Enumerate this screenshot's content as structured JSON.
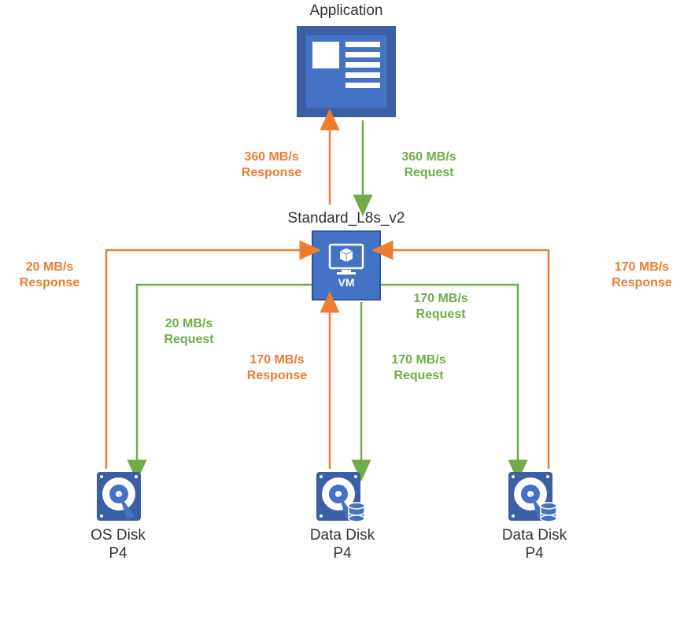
{
  "colors": {
    "primary_blue": "#4472C4",
    "request_green": "#70AD47",
    "response_orange": "#ED7D31"
  },
  "nodes": {
    "application": {
      "label": "Application"
    },
    "vm": {
      "label": "Standard_L8s_v2",
      "caption": "VM"
    },
    "os_disk": {
      "label_line1": "OS Disk",
      "label_line2": "P4"
    },
    "data_disk_1": {
      "label_line1": "Data Disk",
      "label_line2": "P4"
    },
    "data_disk_2": {
      "label_line1": "Data Disk",
      "label_line2": "P4"
    }
  },
  "flows": {
    "app_response": {
      "line1": "360 MB/s",
      "line2": "Response"
    },
    "app_request": {
      "line1": "360 MB/s",
      "line2": "Request"
    },
    "os_response": {
      "line1": "20 MB/s",
      "line2": "Response"
    },
    "os_request": {
      "line1": "20 MB/s",
      "line2": "Request"
    },
    "d1_response": {
      "line1": "170 MB/s",
      "line2": "Response"
    },
    "d1_request": {
      "line1": "170 MB/s",
      "line2": "Request"
    },
    "d2_response": {
      "line1": "170 MB/s",
      "line2": "Response"
    },
    "d2_request": {
      "line1": "170 MB/s",
      "line2": "Request"
    }
  }
}
